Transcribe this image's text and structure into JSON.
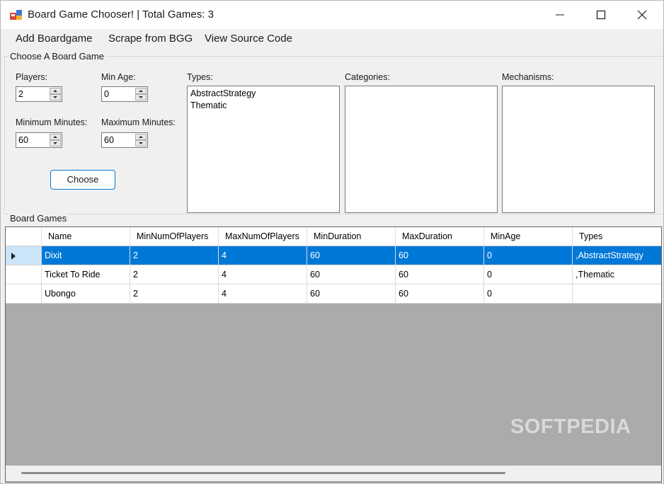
{
  "window": {
    "title": "Board Game Chooser! | Total Games: 3"
  },
  "menu": {
    "items": [
      "Add Boardgame",
      "Scrape from BGG",
      "View Source Code"
    ]
  },
  "chooser": {
    "group_label": "Choose A Board Game",
    "players_label": "Players:",
    "players_value": "2",
    "min_age_label": "Min Age:",
    "min_age_value": "0",
    "min_minutes_label": "Minimum Minutes:",
    "min_minutes_value": "60",
    "max_minutes_label": "Maximum Minutes:",
    "max_minutes_value": "60",
    "choose_button": "Choose",
    "types_label": "Types:",
    "types": [
      "AbstractStrategy",
      "Thematic"
    ],
    "categories_label": "Categories:",
    "categories": [],
    "mechanisms_label": "Mechanisms:",
    "mechanisms": []
  },
  "board_games": {
    "group_label": "Board Games",
    "columns": [
      "Name",
      "MinNumOfPlayers",
      "MaxNumOfPlayers",
      "MinDuration",
      "MaxDuration",
      "MinAge",
      "Types"
    ],
    "rows": [
      [
        "Dixit",
        "2",
        "4",
        "60",
        "60",
        "0",
        ",AbstractStrategy"
      ],
      [
        "Ticket To Ride",
        "2",
        "4",
        "60",
        "60",
        "0",
        ",Thematic"
      ],
      [
        "Ubongo",
        "2",
        "4",
        "60",
        "60",
        "0",
        ""
      ]
    ],
    "selected_row": 0
  },
  "watermark": "SOFTPEDIA",
  "colors": {
    "selection": "#0078d7",
    "accent_border": "#0078d4",
    "grid_background": "#ababab"
  }
}
